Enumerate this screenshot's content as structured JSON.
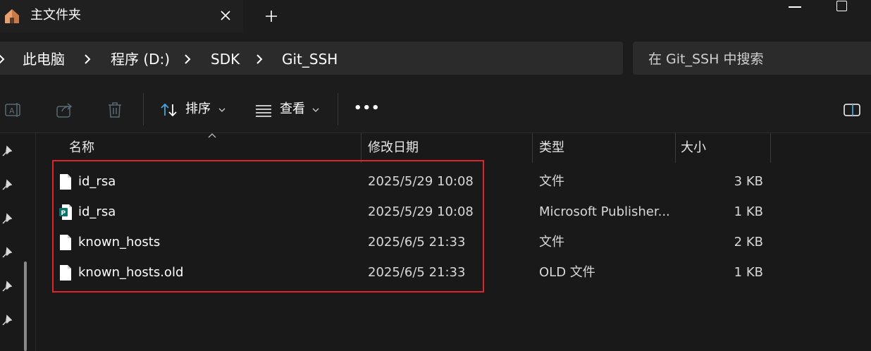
{
  "window": {
    "tab_title": "主文件夹",
    "icons": {
      "home": "home-icon",
      "close": "close-icon",
      "new_tab": "plus-icon",
      "minimize": "minimize-icon",
      "maximize": "maximize-icon"
    }
  },
  "address": {
    "crumbs": [
      "此电脑",
      "程序 (D:)",
      "SDK",
      "Git_SSH"
    ],
    "search_placeholder": "在 Git_SSH 中搜索"
  },
  "toolbar": {
    "sort_label": "排序",
    "view_label": "查看",
    "more_label": "•••"
  },
  "columns": {
    "name": "名称",
    "modified": "修改日期",
    "type": "类型",
    "size": "大小"
  },
  "files": [
    {
      "name": "id_rsa",
      "modified": "2025/5/29 10:08",
      "type": "文件",
      "size": "3 KB",
      "icon": "file-icon"
    },
    {
      "name": "id_rsa",
      "modified": "2025/5/29 10:08",
      "type": "Microsoft Publisher...",
      "size": "1 KB",
      "icon": "publisher-file-icon"
    },
    {
      "name": "known_hosts",
      "modified": "2025/6/5 21:33",
      "type": "文件",
      "size": "2 KB",
      "icon": "file-icon"
    },
    {
      "name": "known_hosts.old",
      "modified": "2025/6/5 21:33",
      "type": "OLD 文件",
      "size": "1 KB",
      "icon": "file-icon"
    }
  ],
  "colors": {
    "highlight": "#e0242b",
    "accent": "#4aa3df",
    "publisher": "#077568"
  }
}
